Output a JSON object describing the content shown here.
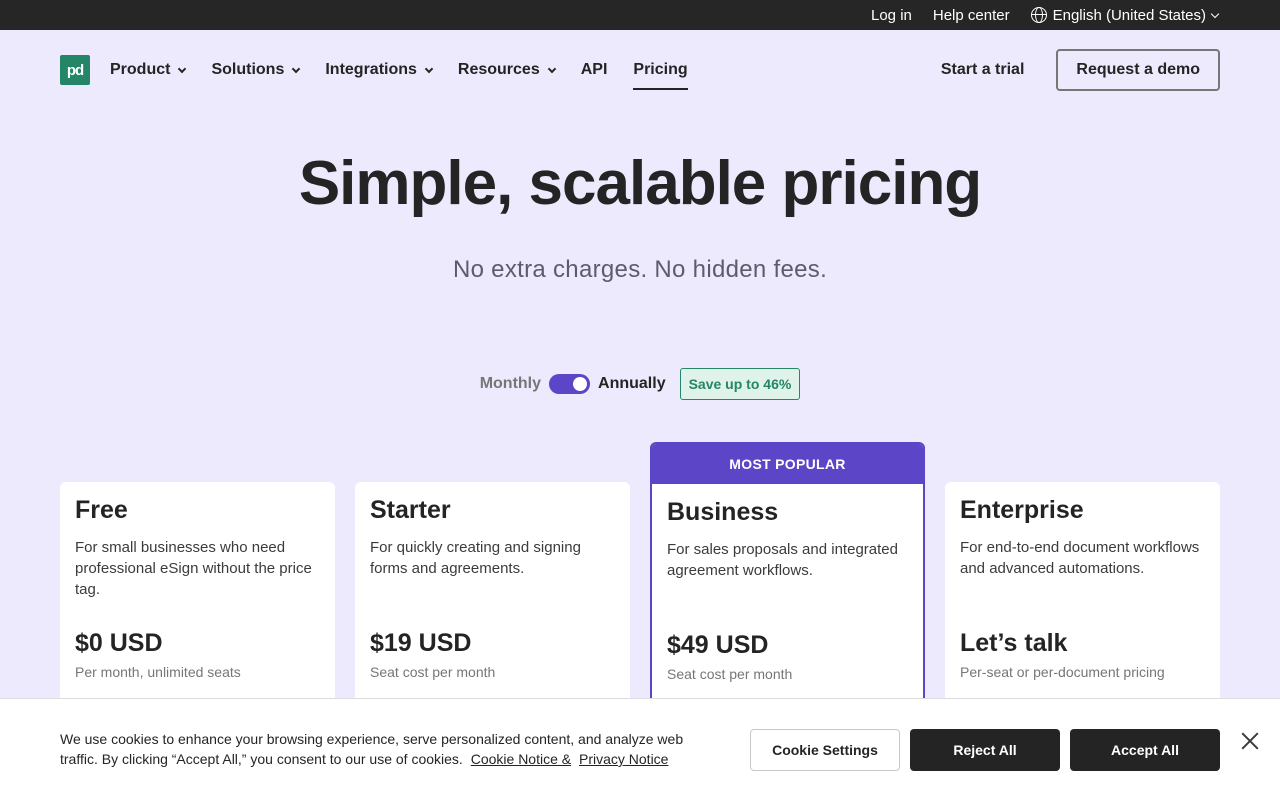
{
  "topbar": {
    "login": "Log in",
    "help": "Help center",
    "language": "English (United States)"
  },
  "nav": {
    "logo_text": "pd",
    "items": [
      {
        "label": "Product",
        "dropdown": true
      },
      {
        "label": "Solutions",
        "dropdown": true
      },
      {
        "label": "Integrations",
        "dropdown": true
      },
      {
        "label": "Resources",
        "dropdown": true
      },
      {
        "label": "API",
        "dropdown": false
      },
      {
        "label": "Pricing",
        "dropdown": false,
        "active": true
      }
    ],
    "trial": "Start a trial",
    "demo": "Request a demo"
  },
  "hero": {
    "title": "Simple, scalable pricing",
    "subtitle": "No extra charges. No hidden fees."
  },
  "billing": {
    "monthly": "Monthly",
    "annually": "Annually",
    "toggle_state": "annually",
    "save_badge": "Save up to 46%"
  },
  "plans": [
    {
      "name": "Free",
      "desc": "For small businesses who need professional eSign without the price tag.",
      "price": "$0 USD",
      "unit": "Per month, unlimited seats"
    },
    {
      "name": "Starter",
      "desc": "For quickly creating and signing forms and agreements.",
      "price": "$19 USD",
      "unit": "Seat cost per month"
    },
    {
      "name": "Business",
      "badge": "MOST POPULAR",
      "desc": "For sales proposals and integrated agreement workflows.",
      "price": "$49 USD",
      "unit": "Seat cost per month"
    },
    {
      "name": "Enterprise",
      "desc": "For end-to-end document workflows and advanced automations.",
      "price": "Let’s talk",
      "unit": "Per-seat or per-document pricing"
    }
  ],
  "cookie": {
    "text": "We use cookies to enhance your browsing experience, serve personalized content, and analyze web traffic. By clicking “Accept All,” you consent to our use of cookies.",
    "notice_link": "Cookie Notice &",
    "privacy_link": "Privacy Notice",
    "settings": "Cookie Settings",
    "reject": "Reject All",
    "accept": "Accept All"
  },
  "colors": {
    "brand_green": "#248567",
    "accent_purple": "#5c45c7",
    "background": "#eeeafe",
    "dark": "#242424"
  }
}
